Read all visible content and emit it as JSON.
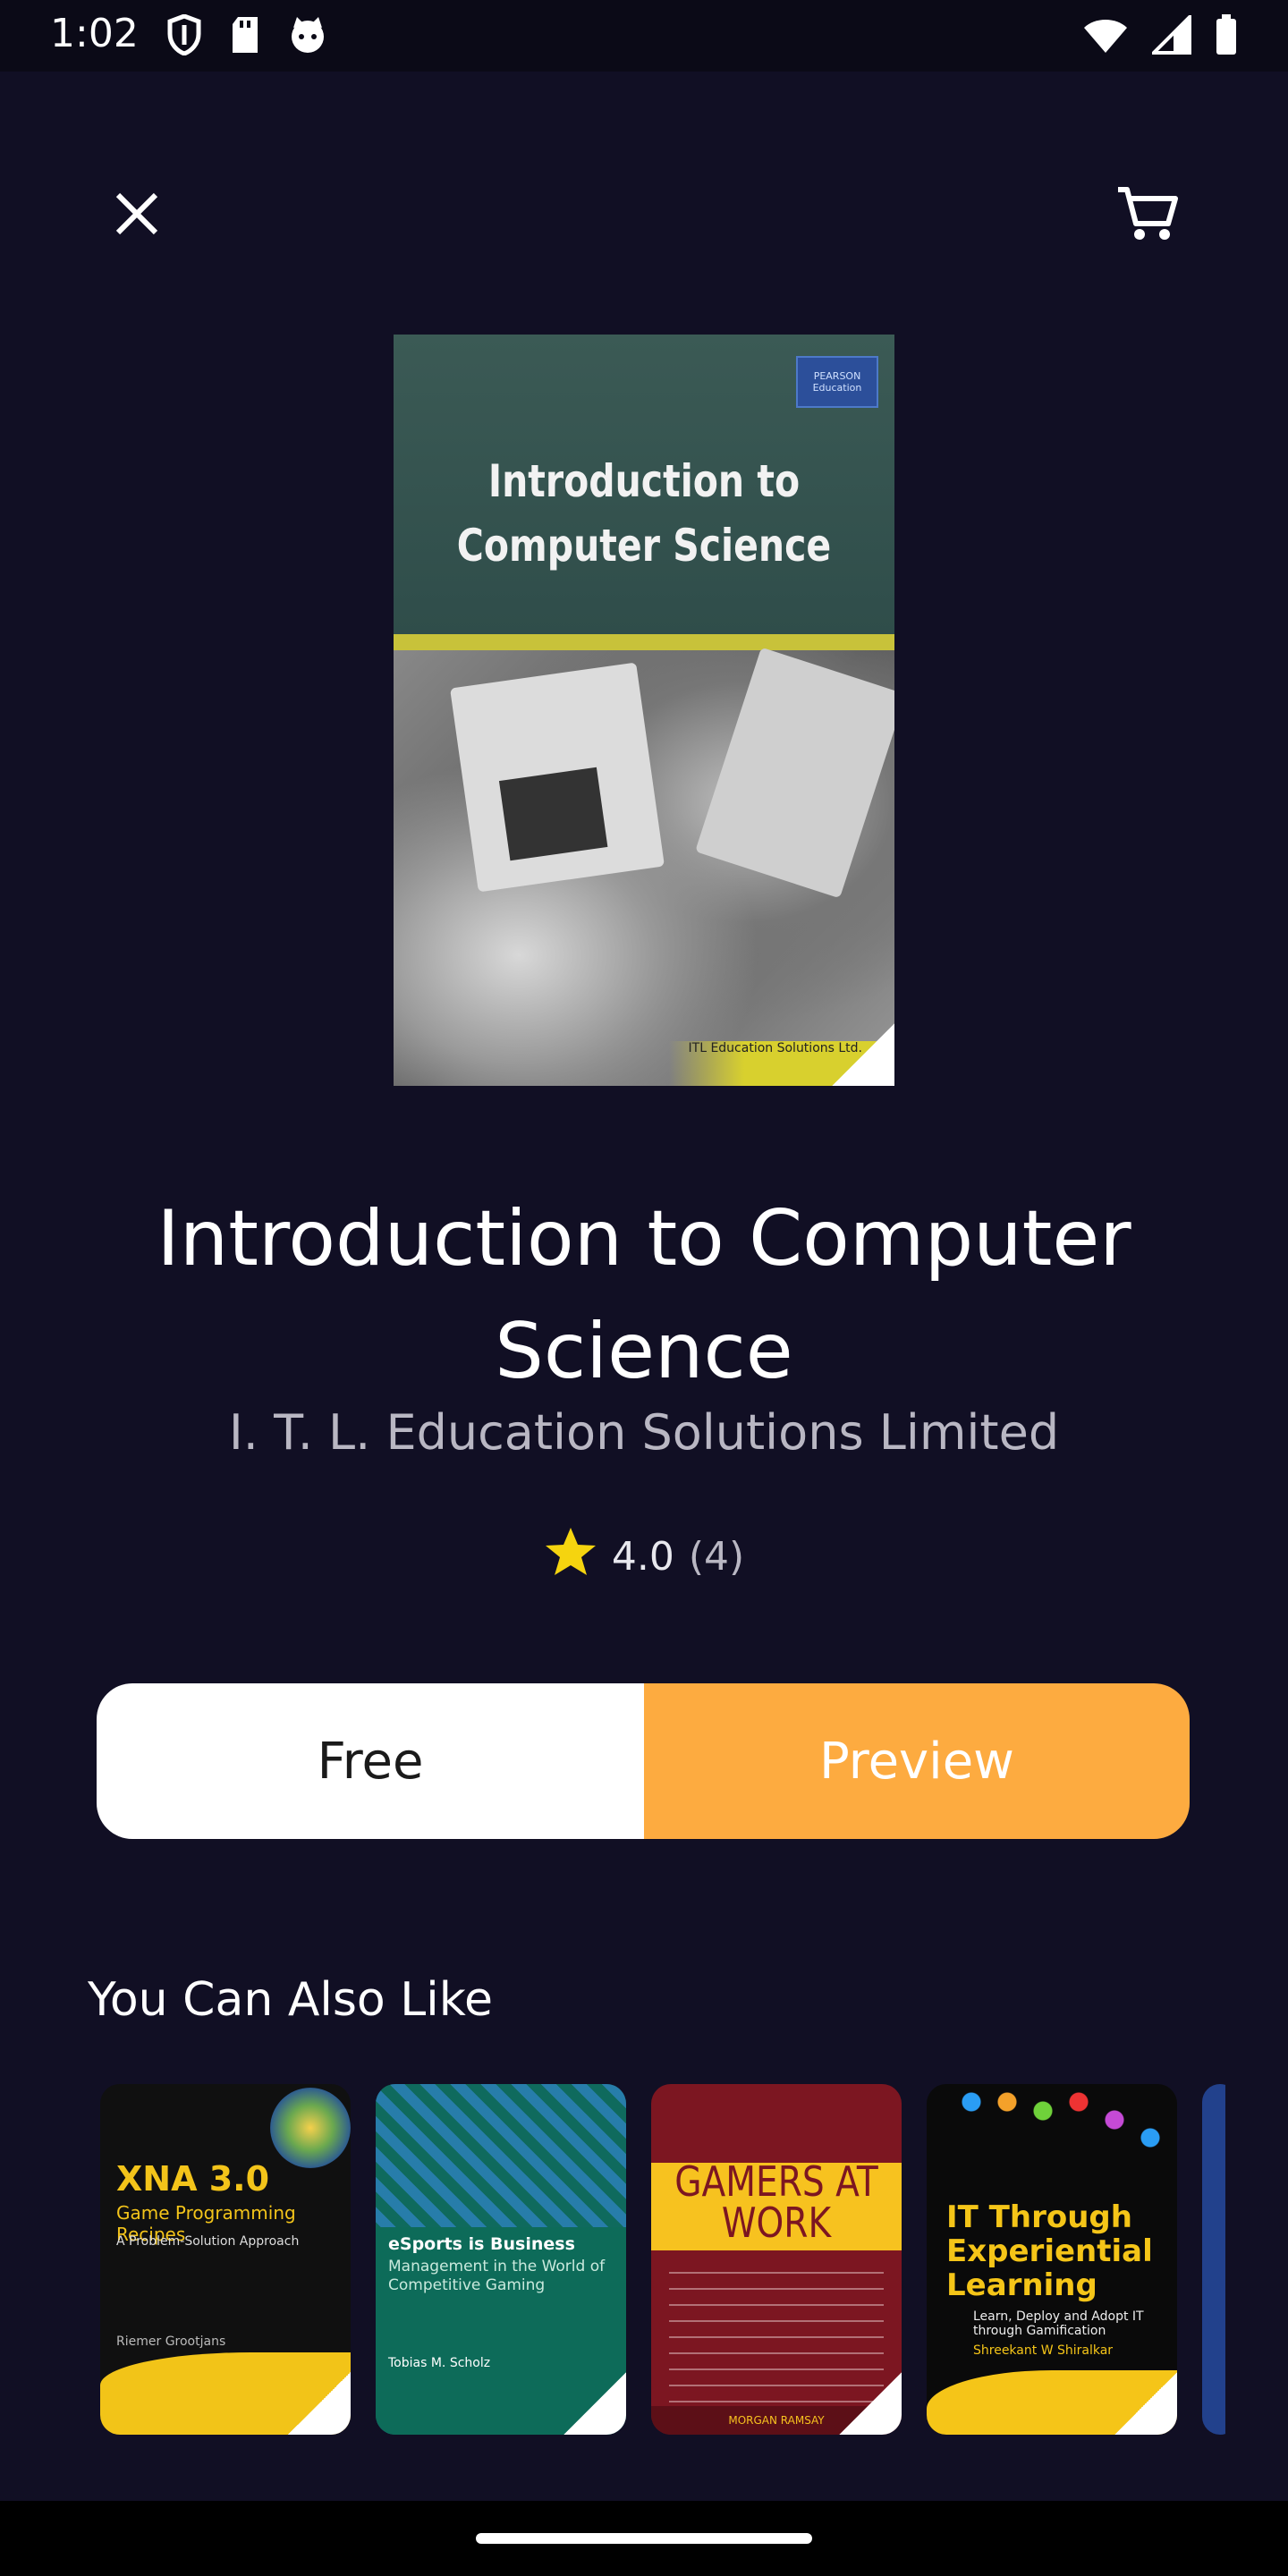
{
  "status_bar": {
    "time": "1:02",
    "left_icons": [
      "shield-icon",
      "sd-card-icon",
      "cat-face-icon"
    ],
    "right_icons": [
      "wifi-icon",
      "cell-signal-icon",
      "battery-icon"
    ]
  },
  "top_bar": {
    "close_icon": "close-icon",
    "cart_icon": "shopping-cart-icon"
  },
  "book": {
    "cover": {
      "title": "Introduction to Computer Science",
      "publisher_badge": "PEARSON Education",
      "footer_text": "ITL Education Solutions Ltd."
    },
    "title": "Introduction to Computer Science",
    "author": "I. T. L. Education Solutions Limited",
    "rating_value": "4.0",
    "rating_count": "(4)",
    "rating_icon": "star-icon"
  },
  "actions": {
    "free_label": "Free",
    "preview_label": "Preview"
  },
  "recommendations": {
    "section_title": "You Can Also Like",
    "books": [
      {
        "title": "XNA 3.0",
        "subtitle": "Game Programming Recipes",
        "tagline": "A Problem-Solution Approach",
        "author": "Riemer Grootjans"
      },
      {
        "title": "eSports is Business",
        "subtitle": "Management in the World of Competitive Gaming",
        "author": "Tobias M. Scholz"
      },
      {
        "title": "GAMERS AT WORK",
        "author": "MORGAN RAMSAY"
      },
      {
        "title": "IT Through Experiential Learning",
        "subtitle": "Learn, Deploy and Adopt IT through Gamification",
        "author": "Shreekant W Shiralkar"
      }
    ]
  },
  "colors": {
    "background": "#110f24",
    "accent": "#fdab40",
    "star": "#f5d40f"
  }
}
